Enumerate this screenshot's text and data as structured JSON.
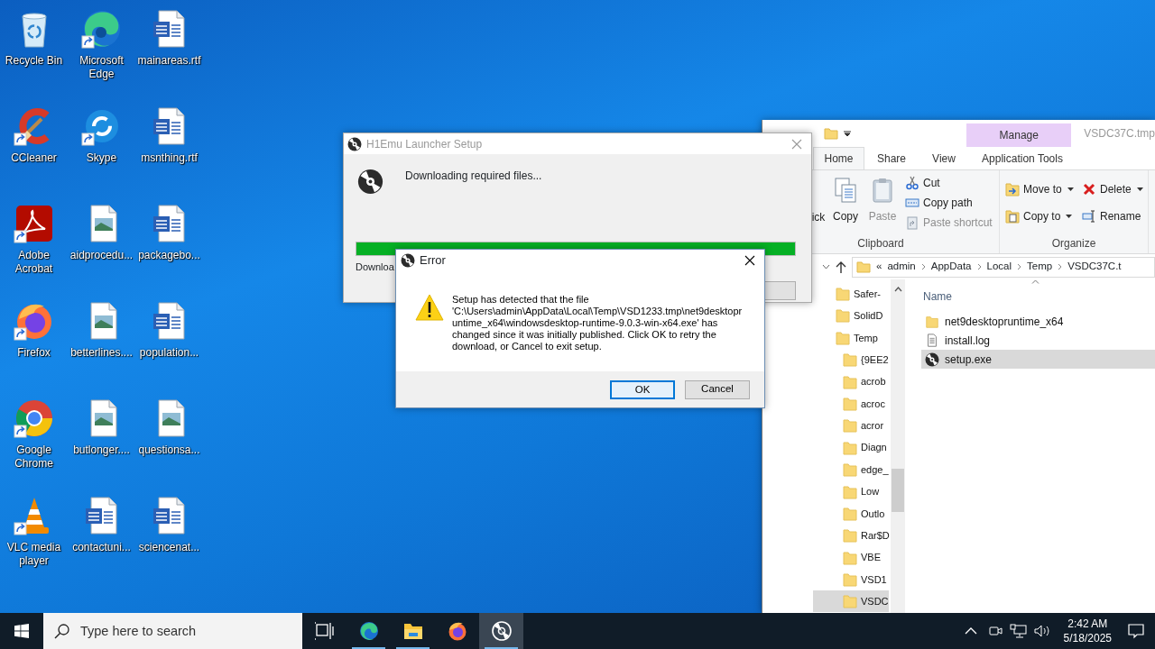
{
  "desktop_icons": [
    {
      "label": "Recycle Bin",
      "kind": "recycle-bin",
      "shortcut": false
    },
    {
      "label": "Microsoft Edge",
      "kind": "edge",
      "shortcut": true
    },
    {
      "label": "mainareas.rtf",
      "kind": "word",
      "shortcut": false
    },
    {
      "label": "CCleaner",
      "kind": "ccleaner",
      "shortcut": true
    },
    {
      "label": "Skype",
      "kind": "skype",
      "shortcut": true
    },
    {
      "label": "msnthing.rtf",
      "kind": "word",
      "shortcut": false
    },
    {
      "label": "Adobe Acrobat",
      "kind": "acrobat",
      "shortcut": true
    },
    {
      "label": "aidprocedu...",
      "kind": "image",
      "shortcut": false
    },
    {
      "label": "packagebo...",
      "kind": "word",
      "shortcut": false
    },
    {
      "label": "Firefox",
      "kind": "firefox",
      "shortcut": true
    },
    {
      "label": "betterlines....",
      "kind": "image",
      "shortcut": false
    },
    {
      "label": "population...",
      "kind": "word",
      "shortcut": false
    },
    {
      "label": "Google Chrome",
      "kind": "chrome",
      "shortcut": true
    },
    {
      "label": "butlonger....",
      "kind": "image",
      "shortcut": false
    },
    {
      "label": "questionsa...",
      "kind": "image",
      "shortcut": false
    },
    {
      "label": "VLC media player",
      "kind": "vlc",
      "shortcut": true
    },
    {
      "label": "contactuni...",
      "kind": "word",
      "shortcut": false
    },
    {
      "label": "sciencenat...",
      "kind": "word",
      "shortcut": false
    }
  ],
  "explorer": {
    "context_tab": "Manage",
    "title": "VSDC37C.tmp",
    "tabs": [
      {
        "label": "Home",
        "selected": true
      },
      {
        "label": "Share",
        "selected": false
      },
      {
        "label": "View",
        "selected": false
      },
      {
        "label": "Application Tools",
        "selected": false
      }
    ],
    "ribbon_groups": [
      {
        "label": "Clipboard",
        "items": [
          {
            "label": "ick",
            "kind": "pin",
            "disabled": false
          },
          {
            "label": "Copy",
            "kind": "copy",
            "disabled": false
          },
          {
            "label": "Paste",
            "kind": "paste",
            "disabled": true
          },
          {
            "label": "Cut",
            "kind": "cut",
            "disabled": false
          },
          {
            "label": "Copy path",
            "kind": "copy-path",
            "disabled": false
          },
          {
            "label": "Paste shortcut",
            "kind": "paste-shortcut",
            "disabled": true
          }
        ]
      },
      {
        "label": "Organize",
        "items": [
          {
            "label": "Move to",
            "kind": "move-to",
            "disabled": false
          },
          {
            "label": "Copy to",
            "kind": "copy-to",
            "disabled": false
          },
          {
            "label": "Delete",
            "kind": "delete",
            "disabled": false
          },
          {
            "label": "Rename",
            "kind": "rename",
            "disabled": false
          }
        ]
      }
    ],
    "address": {
      "overflow": "«",
      "crumbs": [
        "admin",
        "AppData",
        "Local",
        "Temp",
        "VSDC37C.t"
      ]
    },
    "nav_tree": [
      {
        "label": "Safer-",
        "selected": false
      },
      {
        "label": "SolidD",
        "selected": false
      },
      {
        "label": "Temp",
        "selected": false,
        "children": [
          {
            "label": "{9EE2",
            "selected": false
          },
          {
            "label": "acrob",
            "selected": false
          },
          {
            "label": "acroc",
            "selected": false
          },
          {
            "label": "acror",
            "selected": false
          },
          {
            "label": "Diagn",
            "selected": false
          },
          {
            "label": "edge_",
            "selected": false
          },
          {
            "label": "Low",
            "selected": false
          },
          {
            "label": "Outlo",
            "selected": false
          },
          {
            "label": "Rar$D",
            "selected": false
          },
          {
            "label": "VBE",
            "selected": false
          },
          {
            "label": "VSD1",
            "selected": false
          },
          {
            "label": "VSDC",
            "selected": true
          }
        ]
      }
    ],
    "column": "Name",
    "files": [
      {
        "name": "net9desktopruntime_x64",
        "kind": "folder",
        "selected": false
      },
      {
        "name": "install.log",
        "kind": "text",
        "selected": false
      },
      {
        "name": "setup.exe",
        "kind": "exe",
        "selected": true
      }
    ]
  },
  "setup_window": {
    "title": "H1Emu Launcher Setup",
    "active": false,
    "message": "Downloading required files...",
    "progress": {
      "level": 1.0
    },
    "status": "Downloa"
  },
  "error_dialog": {
    "title": "Error",
    "message": "Setup has detected that the file 'C:\\Users\\admin\\AppData\\Local\\Temp\\VSD1233.tmp\\net9desktopruntime_x64\\windowsdesktop-runtime-9.0.3-win-x64.exe' has changed since it was initially published. Click OK to retry the download, or Cancel to exit setup.",
    "buttons": [
      {
        "label": "OK",
        "selected": true
      },
      {
        "label": "Cancel",
        "selected": false
      }
    ]
  },
  "taskbar": {
    "search_placeholder": "Type here to search",
    "apps": [
      {
        "kind": "task-view",
        "running": false,
        "selected": false
      },
      {
        "kind": "edge",
        "running": true,
        "selected": false
      },
      {
        "kind": "explorer",
        "running": true,
        "selected": false
      },
      {
        "kind": "firefox",
        "running": false,
        "selected": false
      },
      {
        "kind": "setup",
        "running": true,
        "selected": true
      }
    ],
    "time": "2:42 AM",
    "date": "5/18/2025"
  }
}
